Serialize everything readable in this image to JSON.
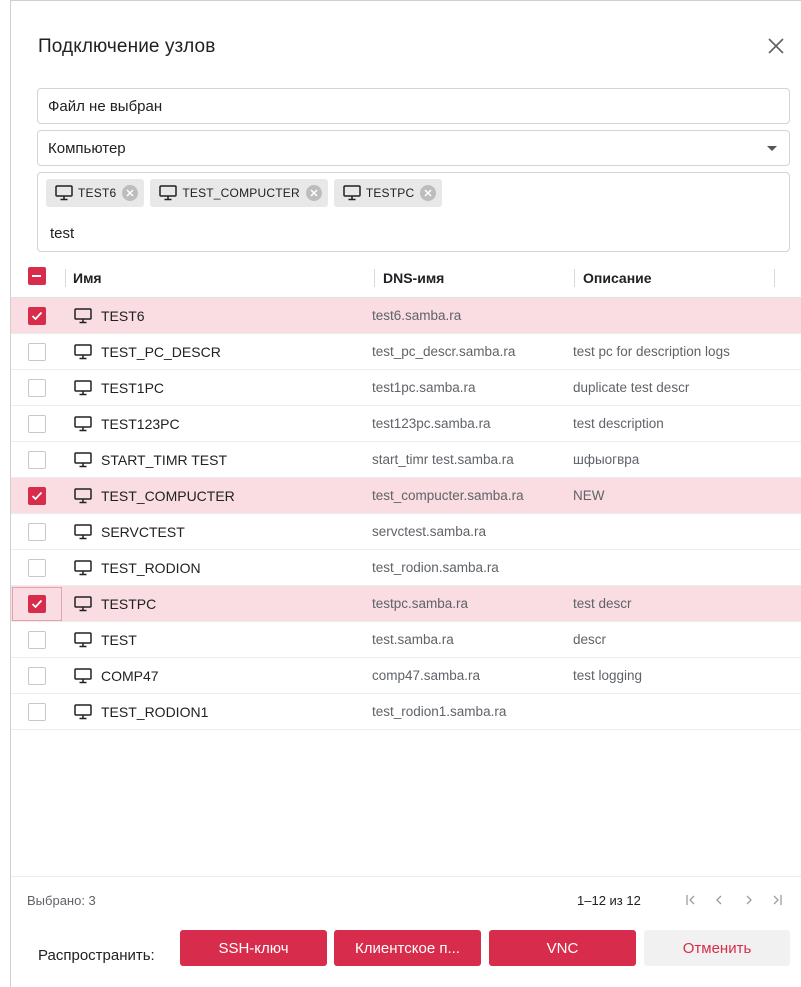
{
  "dialog": {
    "title": "Подключение узлов",
    "close_icon": "close-icon"
  },
  "file_field": {
    "value": "Файл не выбран"
  },
  "type_select": {
    "value": "Компьютер"
  },
  "chips_field": {
    "chips": [
      {
        "label": "TEST6",
        "icon": "computer-icon"
      },
      {
        "label": "TEST_COMPUCTER",
        "icon": "computer-icon"
      },
      {
        "label": "TESTPC",
        "icon": "computer-icon"
      }
    ],
    "input_value": "test"
  },
  "table": {
    "headers": {
      "name": "Имя",
      "dns": "DNS-имя",
      "description": "Описание"
    },
    "rows": [
      {
        "name": "TEST6",
        "dns": "test6.samba.ra",
        "description": "",
        "checked": true
      },
      {
        "name": "TEST_PC_DESCR",
        "dns": "test_pc_descr.samba.ra",
        "description": "test pc for description logs",
        "checked": false
      },
      {
        "name": "TEST1PC",
        "dns": "test1pc.samba.ra",
        "description": "duplicate test descr",
        "checked": false
      },
      {
        "name": "TEST123PC",
        "dns": "test123pc.samba.ra",
        "description": "test description",
        "checked": false
      },
      {
        "name": "START_TIMR TEST",
        "dns": "start_timr test.samba.ra",
        "description": "шфыогвра",
        "checked": false
      },
      {
        "name": "TEST_COMPUCTER",
        "dns": "test_compucter.samba.ra",
        "description": "NEW",
        "checked": true
      },
      {
        "name": "SERVCTEST",
        "dns": "servctest.samba.ra",
        "description": "",
        "checked": false
      },
      {
        "name": "TEST_RODION",
        "dns": "test_rodion.samba.ra",
        "description": "",
        "checked": false
      },
      {
        "name": "TESTPC",
        "dns": "testpc.samba.ra",
        "description": "test descr",
        "checked": true
      },
      {
        "name": "TEST",
        "dns": "test.samba.ra",
        "description": "descr",
        "checked": false
      },
      {
        "name": "COMP47",
        "dns": "comp47.samba.ra",
        "description": "test logging",
        "checked": false
      },
      {
        "name": "TEST_RODION1",
        "dns": "test_rodion1.samba.ra",
        "description": "",
        "checked": false
      }
    ]
  },
  "footer": {
    "selected": "Выбрано: 3",
    "range": "1–12 из 12"
  },
  "actions": {
    "share_label": "Распространить:",
    "ssh_button": "SSH-ключ",
    "client_button": "Клиентское п...",
    "vnc_button": "VNC",
    "cancel_button": "Отменить"
  },
  "colors": {
    "accent": "#d72c4b",
    "selected_row": "#f9dde2"
  }
}
